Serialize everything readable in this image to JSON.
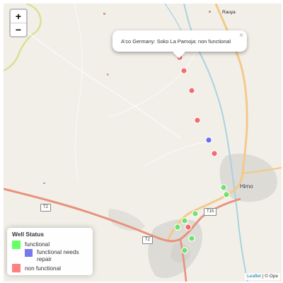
{
  "map": {
    "places": [
      "Rauya",
      "Himo"
    ],
    "road_shields": [
      "T2",
      "T2",
      "T15"
    ]
  },
  "zoom": {
    "in_label": "+",
    "out_label": "−"
  },
  "popup": {
    "text": "A'co Germany: Soko La Pamoja: non functional",
    "close_label": "×"
  },
  "legend": {
    "title": "Well Status",
    "items": [
      {
        "label_lines": [
          "functional"
        ],
        "color": "#66ff66"
      },
      {
        "label_lines": [
          "functional needs",
          "repair"
        ],
        "color": "#7777ee"
      },
      {
        "label_lines": [
          "non functional"
        ],
        "color": "#ff8080"
      }
    ]
  },
  "wells": [
    {
      "status": "non functional",
      "color": "#f25757"
    },
    {
      "status": "non functional",
      "color": "#f25757"
    },
    {
      "status": "non functional",
      "color": "#f25757"
    },
    {
      "status": "non functional",
      "color": "#f25757"
    },
    {
      "status": "functional needs repair",
      "color": "#5555ee"
    },
    {
      "status": "non functional",
      "color": "#f25757"
    },
    {
      "status": "functional",
      "color": "#5ee05e"
    },
    {
      "status": "functional",
      "color": "#5ee05e"
    },
    {
      "status": "functional",
      "color": "#5ee05e"
    },
    {
      "status": "functional",
      "color": "#5ee05e"
    },
    {
      "status": "non functional",
      "color": "#f25757"
    },
    {
      "status": "functional",
      "color": "#5ee05e"
    },
    {
      "status": "functional",
      "color": "#5ee05e"
    },
    {
      "status": "functional",
      "color": "#5ee05e"
    }
  ],
  "attribution": {
    "leaflet": "Leaflet",
    "sep": " | © ",
    "osm": "Ope"
  }
}
